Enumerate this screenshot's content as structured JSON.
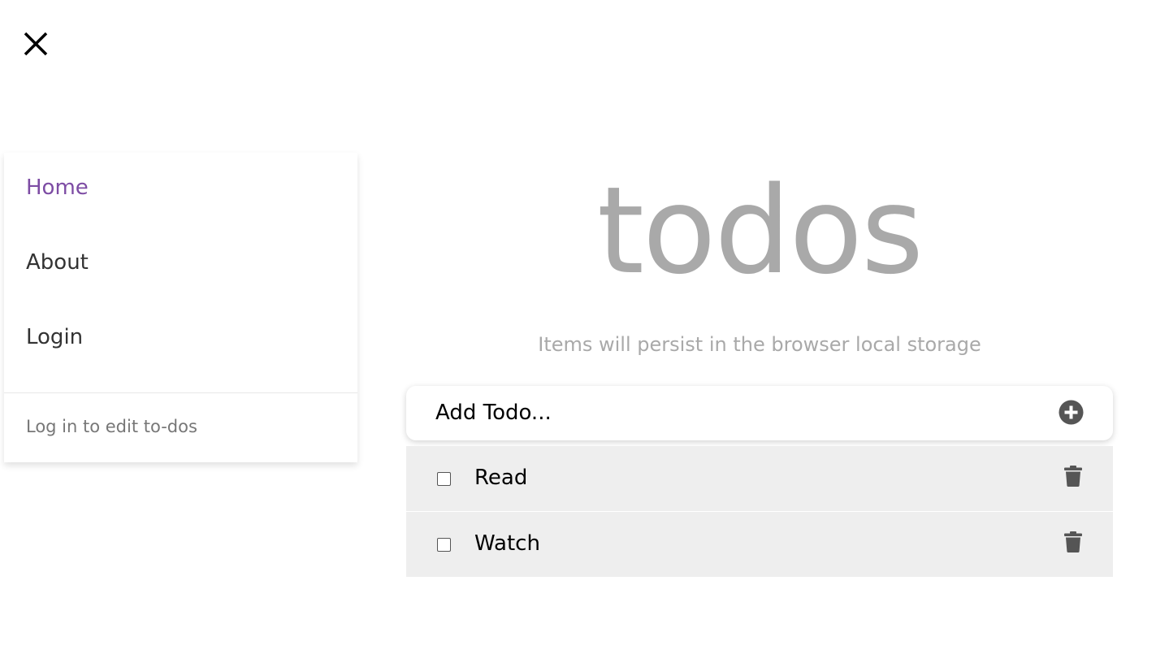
{
  "menu": {
    "items": [
      {
        "label": "Home",
        "active": true
      },
      {
        "label": "About",
        "active": false
      },
      {
        "label": "Login",
        "active": false
      }
    ],
    "footer": "Log in to edit to-dos",
    "accent_color": "#7d4ca4"
  },
  "main": {
    "title": "todos",
    "subtitle": "Items will persist in the browser local storage",
    "add_placeholder": "Add Todo..."
  },
  "todos": [
    {
      "text": "Read",
      "done": false
    },
    {
      "text": "Watch",
      "done": false
    }
  ],
  "icons": {
    "close": "close-icon",
    "add": "plus-circle-icon",
    "delete": "trash-icon"
  }
}
